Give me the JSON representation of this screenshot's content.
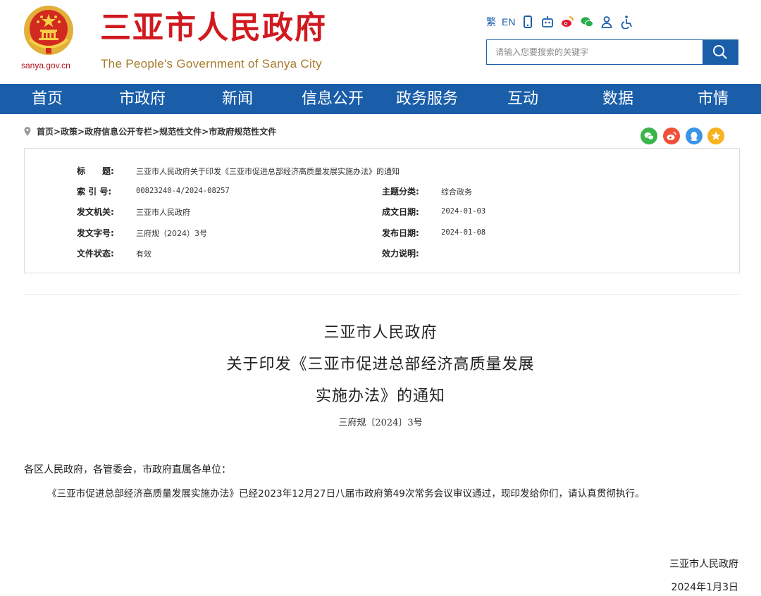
{
  "header": {
    "domain": "sanya.gov.cn",
    "brand_cn": "三亚市人民政府",
    "brand_en": "The People's Government of Sanya City",
    "toolbar": {
      "traditional": "繁",
      "english": "EN",
      "icons": [
        "mobile-icon",
        "robot-icon",
        "weibo-icon",
        "wechat-icon",
        "user-icon",
        "accessibility-icon"
      ]
    },
    "search": {
      "placeholder": "请输入您要搜索的关键字"
    }
  },
  "nav": {
    "items": [
      "首页",
      "市政府",
      "新闻",
      "信息公开",
      "政务服务",
      "互动",
      "数据",
      "市情"
    ]
  },
  "breadcrumb": {
    "text": "首页>政策>政府信息公开专栏>规范性文件>市政府规范性文件",
    "share_icons": [
      "wechat-share-icon",
      "weibo-share-icon",
      "qq-share-icon",
      "favorite-icon"
    ]
  },
  "info": {
    "title_label": "标　　题:",
    "title_value": "三亚市人民政府关于印发《三亚市促进总部经济高质量发展实施办法》的通知",
    "index_label": "索 引 号:",
    "index_value": "00823240-4/2024-08257",
    "topic_label": "主题分类:",
    "topic_value": "综合政务",
    "issuer_label": "发文机关:",
    "issuer_value": "三亚市人民政府",
    "created_label": "成文日期:",
    "created_value": "2024-01-03",
    "docno_label": "发文字号:",
    "docno_value": "三府规（2024）3号",
    "published_label": "发布日期:",
    "published_value": "2024-01-08",
    "status_label": "文件状态:",
    "status_value": "有效",
    "validity_label": "效力说明:",
    "validity_value": ""
  },
  "document": {
    "title_line1": "三亚市人民政府",
    "title_line2": "关于印发《三亚市促进总部经济高质量发展",
    "title_line3": "实施办法》的通知",
    "number": "三府规〔2024〕3号",
    "salutation": "各区人民政府，各管委会，市政府直属各单位：",
    "body": "《三亚市促进总部经济高质量发展实施办法》已经2023年12月27日八届市政府第49次常务会议审议通过，现印发给你们，请认真贯彻执行。",
    "signature": "三亚市人民政府",
    "date": "2024年1月3日"
  },
  "colors": {
    "primary_blue": "#1a5ea9",
    "brand_red": "#d01a20",
    "brand_gold": "#a57a2a"
  }
}
